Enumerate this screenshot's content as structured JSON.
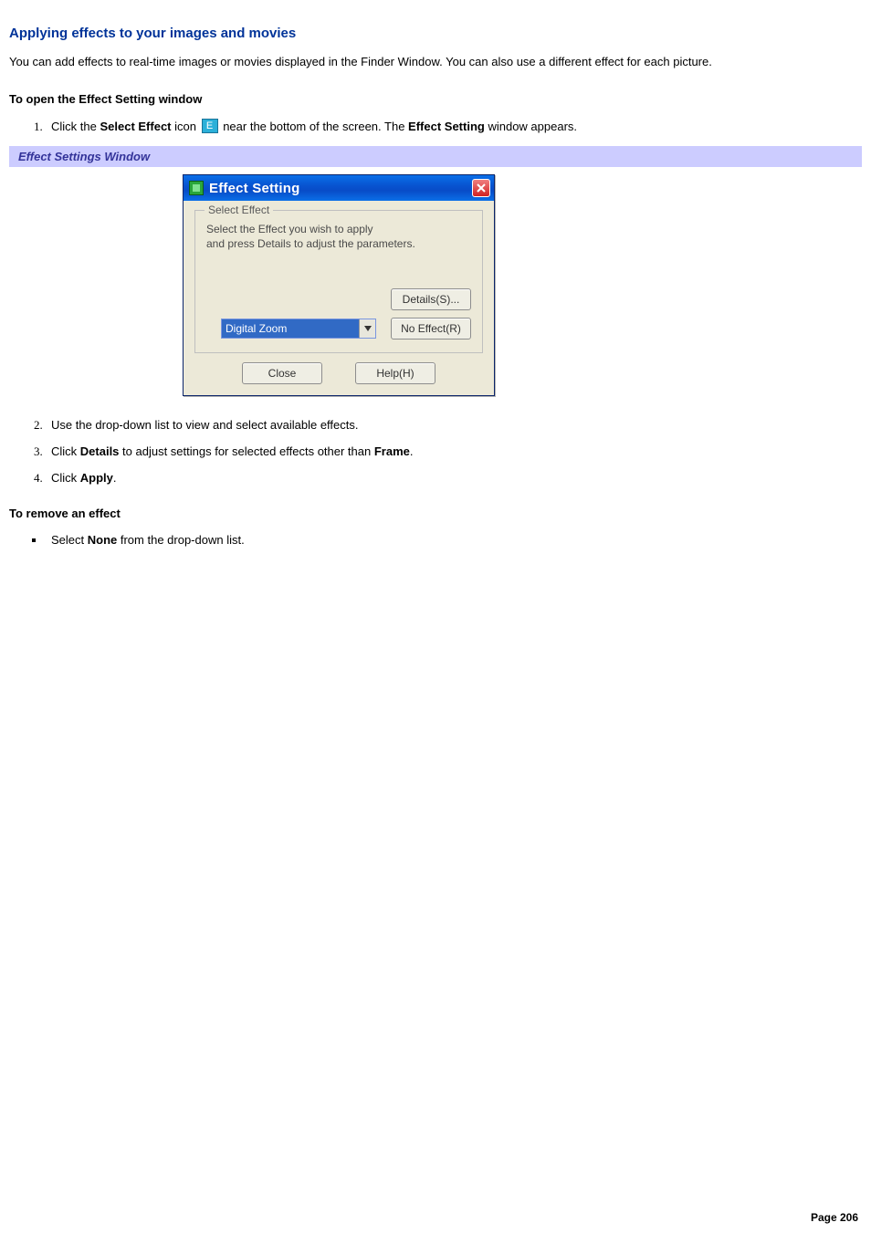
{
  "heading": "Applying effects to your images and movies",
  "intro": "You can add effects to real-time images or movies displayed in the Finder Window. You can also use a different effect for each picture.",
  "section_open_title": "To open the Effect Setting window",
  "steps_open": [
    {
      "prefix": "Click the ",
      "bold1": "Select Effect",
      "mid": " icon ",
      "after_icon": " near the bottom of the screen. The ",
      "bold2": "Effect Setting",
      "suffix": " window appears."
    }
  ],
  "caption_bar": "Effect Settings Window",
  "dialog": {
    "title": "Effect Setting",
    "group_legend": "Select Effect",
    "hint_line1": "Select the Effect you wish to apply",
    "hint_line2": "and press Details to adjust the parameters.",
    "btn_details": "Details(S)...",
    "btn_noeffect": "No Effect(R)",
    "combo_selected": "Digital Zoom",
    "btn_close": "Close",
    "btn_help": "Help(H)"
  },
  "steps_continued": [
    "Use the drop-down list to view and select available effects.",
    {
      "prefix": "Click ",
      "bold1": "Details",
      "mid": " to adjust settings for selected effects other than ",
      "bold2": "Frame",
      "suffix": "."
    },
    {
      "prefix": "Click ",
      "bold1": "Apply",
      "suffix": "."
    }
  ],
  "section_remove_title": "To remove an effect",
  "remove_bullet": {
    "prefix": "Select ",
    "bold1": "None",
    "suffix": " from the drop-down list."
  },
  "page_number": "Page 206"
}
